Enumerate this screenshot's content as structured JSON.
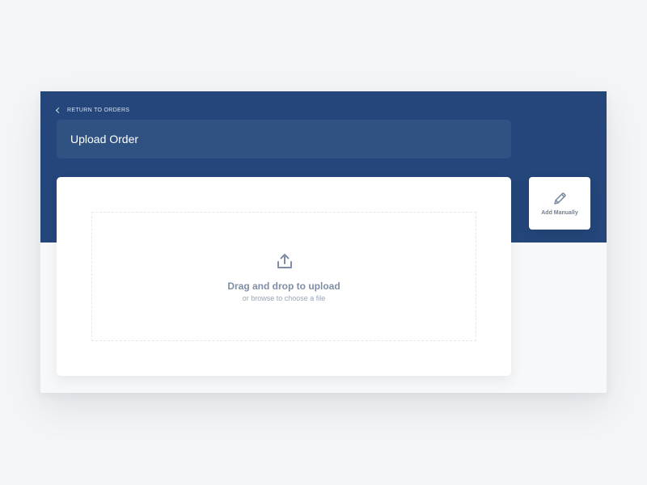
{
  "navigation": {
    "back_label": "RETURN TO ORDERS"
  },
  "header": {
    "title": "Upload Order"
  },
  "upload": {
    "title": "Drag and drop to upload",
    "subtitle": "or browse to choose a file",
    "icon": "upload-icon"
  },
  "manual": {
    "label": "Add Manually",
    "icon": "pencil-icon"
  },
  "colors": {
    "brand": "#24467a",
    "header_input": "#2f5282",
    "text_muted": "#7f8ea5",
    "card_background": "#ffffff"
  }
}
